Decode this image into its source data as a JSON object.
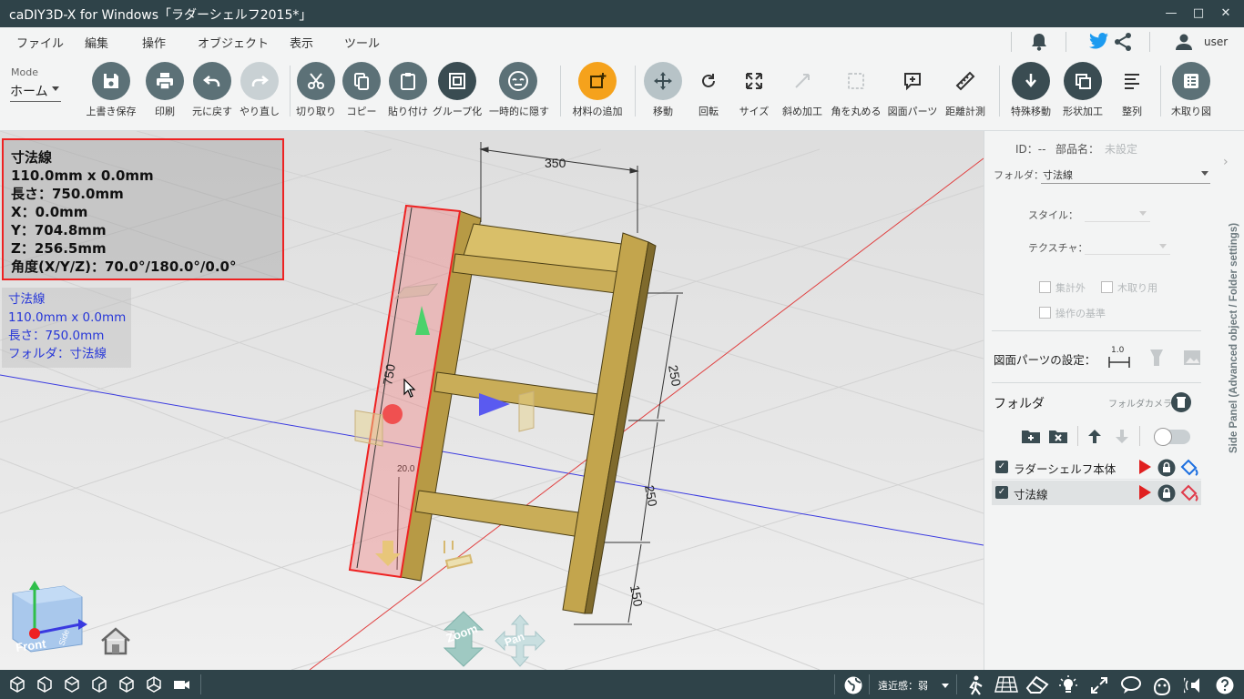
{
  "window": {
    "title": "caDIY3D-X for Windows「ラダーシェルフ2015*」",
    "minimize": "—",
    "maximize": "□",
    "close": "✕"
  },
  "menu": {
    "items": [
      "ファイル",
      "編集",
      "操作",
      "オブジェクト",
      "表示",
      "ツール"
    ],
    "user": "user"
  },
  "mode": {
    "label": "Mode",
    "value": "ホーム"
  },
  "toolbar": {
    "items": [
      {
        "label": "上書き保存",
        "icon": "save-icon"
      },
      {
        "label": "印刷",
        "icon": "print-icon"
      },
      {
        "label": "元に戻す",
        "icon": "undo-icon"
      },
      {
        "label": "やり直し",
        "icon": "redo-icon"
      },
      {
        "label": "切り取り",
        "icon": "cut-icon"
      },
      {
        "label": "コピー",
        "icon": "copy-icon"
      },
      {
        "label": "貼り付け",
        "icon": "paste-icon"
      },
      {
        "label": "グループ化",
        "icon": "group-icon"
      },
      {
        "label": "一時的に隠す",
        "icon": "hide-icon"
      },
      {
        "label": "材料の追加",
        "icon": "add-material-icon"
      },
      {
        "label": "移動",
        "icon": "move-icon"
      },
      {
        "label": "回転",
        "icon": "rotate-icon"
      },
      {
        "label": "サイズ",
        "icon": "size-icon"
      },
      {
        "label": "斜め加工",
        "icon": "bevel-icon"
      },
      {
        "label": "角を丸める",
        "icon": "round-corner-icon"
      },
      {
        "label": "図面パーツ",
        "icon": "drawing-parts-icon"
      },
      {
        "label": "距離計測",
        "icon": "ruler-icon"
      },
      {
        "label": "特殊移動",
        "icon": "special-move-icon"
      },
      {
        "label": "形状加工",
        "icon": "shape-icon"
      },
      {
        "label": "整列",
        "icon": "align-icon"
      },
      {
        "label": "木取り図",
        "icon": "cutting-list-icon"
      }
    ]
  },
  "info_box": {
    "lines": [
      "寸法線",
      "110.0mm x 0.0mm",
      "長さ：750.0mm",
      "X：0.0mm",
      "Y：704.8mm",
      "Z：256.5mm",
      "角度(X/Y/Z)：70.0°/180.0°/0.0°"
    ]
  },
  "info_box2": {
    "lines": [
      "寸法線",
      "110.0mm x 0.0mm",
      "長さ：750.0mm",
      "フォルダ：寸法線"
    ]
  },
  "dimensions": {
    "top_width": "350",
    "shelf_gap_upper": "250",
    "shelf_gap_lower": "250",
    "bottom_gap": "150",
    "leg_length": "750",
    "small": "20.0"
  },
  "nav": {
    "cube_front": "Front",
    "cube_side": "Side",
    "zoom": "Zoom",
    "pan": "Pan"
  },
  "side_panel": {
    "id_label": "ID：--",
    "part_name_label": "部品名：",
    "part_name_placeholder": "未設定",
    "folder_label": "フォルダ：",
    "folder_value": "寸法線",
    "style_label": "スタイル：",
    "texture_label": "テクスチャ：",
    "check_exclude": "集計外",
    "check_cutting": "木取り用",
    "check_base": "操作の基準",
    "drawing_parts_label": "図面パーツの設定：",
    "drawing_scale": "1.0",
    "folder_section": "フォルダ",
    "folder_camera": "フォルダカメラ",
    "vertical_title": "Side Panel (Advanced object / Folder settings)",
    "folders": [
      {
        "name": "ラダーシェルフ本体",
        "checked": true
      },
      {
        "name": "寸法線",
        "checked": true
      }
    ]
  },
  "status": {
    "perspective": "遠近感：弱"
  },
  "colors": {
    "titlebar": "#2f4349",
    "button_gray": "#5c7177",
    "accent_orange": "#f5a21c",
    "selection_red": "#e22222",
    "wood": "#c9ad58"
  }
}
